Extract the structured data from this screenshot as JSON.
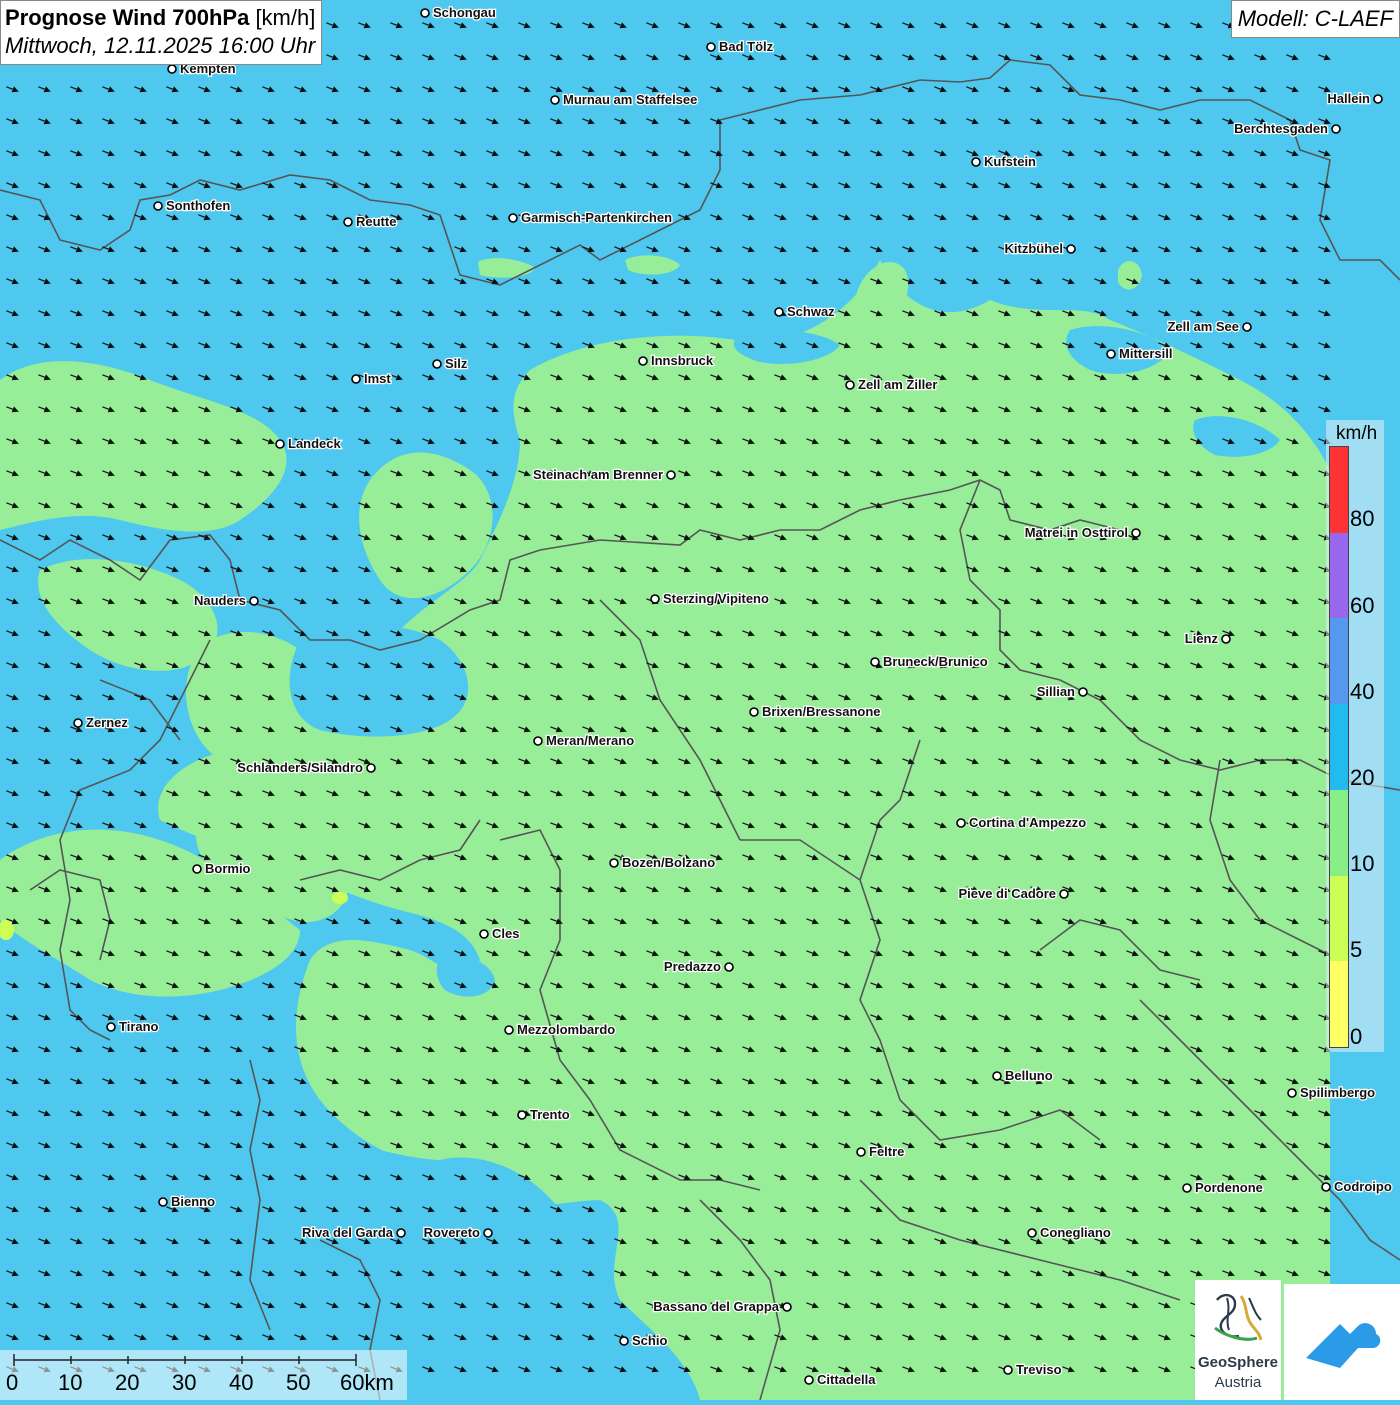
{
  "header": {
    "title_bold": "Prognose Wind 700hPa",
    "title_unit": "[km/h]",
    "datetime": "Mittwoch, 12.11.2025 16:00 Uhr"
  },
  "model": {
    "label": "Modell: C-LAEF"
  },
  "legend": {
    "unit": "km/h",
    "segments": [
      {
        "color": "#ff3333"
      },
      {
        "color": "#9966ee"
      },
      {
        "color": "#5599ee"
      },
      {
        "color": "#22bbee"
      },
      {
        "color": "#88ee88"
      },
      {
        "color": "#ccff55"
      },
      {
        "color": "#ffff66"
      }
    ],
    "labels": [
      "80",
      "60",
      "40",
      "20",
      "10",
      "5",
      "0"
    ]
  },
  "scalebar": {
    "labels": [
      "0",
      "10",
      "20",
      "30",
      "40",
      "50",
      "60km"
    ]
  },
  "logos": {
    "geosphere_line1": "GeoSphere",
    "geosphere_line2": "Austria"
  },
  "colors": {
    "wind_20_40": "#4fc8ef",
    "wind_10_20": "#98ee98",
    "wind_5_10": "#ccff55",
    "border": "#555555",
    "arrow": "#111111"
  },
  "cities": [
    "Schongau",
    "Bad Tölz",
    "Kempten",
    "Murnau am Staffelsee",
    "Hallein",
    "Berchtesgaden",
    "Kufstein",
    "Sonthofen",
    "Reutte",
    "Garmisch-Partenkirchen",
    "Kitzbühel",
    "Schwaz",
    "Zell am See",
    "Mittersill",
    "Innsbruck",
    "Silz",
    "Imst",
    "Zell am Ziller",
    "Landeck",
    "Steinach am Brenner",
    "Matrei in Osttirol",
    "Nauders",
    "Sterzing/Vipiteno",
    "Lienz",
    "Bruneck/Brunico",
    "Sillian",
    "Brixen/Bressanone",
    "Zernez",
    "Meran/Merano",
    "Schlanders/Silandro",
    "Cortina d'Ampezzo",
    "Bozen/Bolzano",
    "Bormio",
    "Pieve di Cadore",
    "Cles",
    "Predazzo",
    "Tirano",
    "Mezzolombardo",
    "Belluno",
    "Spilimbergo",
    "Trento",
    "Feltre",
    "Pordenone",
    "Codroipo",
    "Bienno",
    "Riva del Garda",
    "Rovereto",
    "Conegliano",
    "Bassano del Grappa",
    "Schio",
    "Treviso",
    "Cittadella"
  ]
}
